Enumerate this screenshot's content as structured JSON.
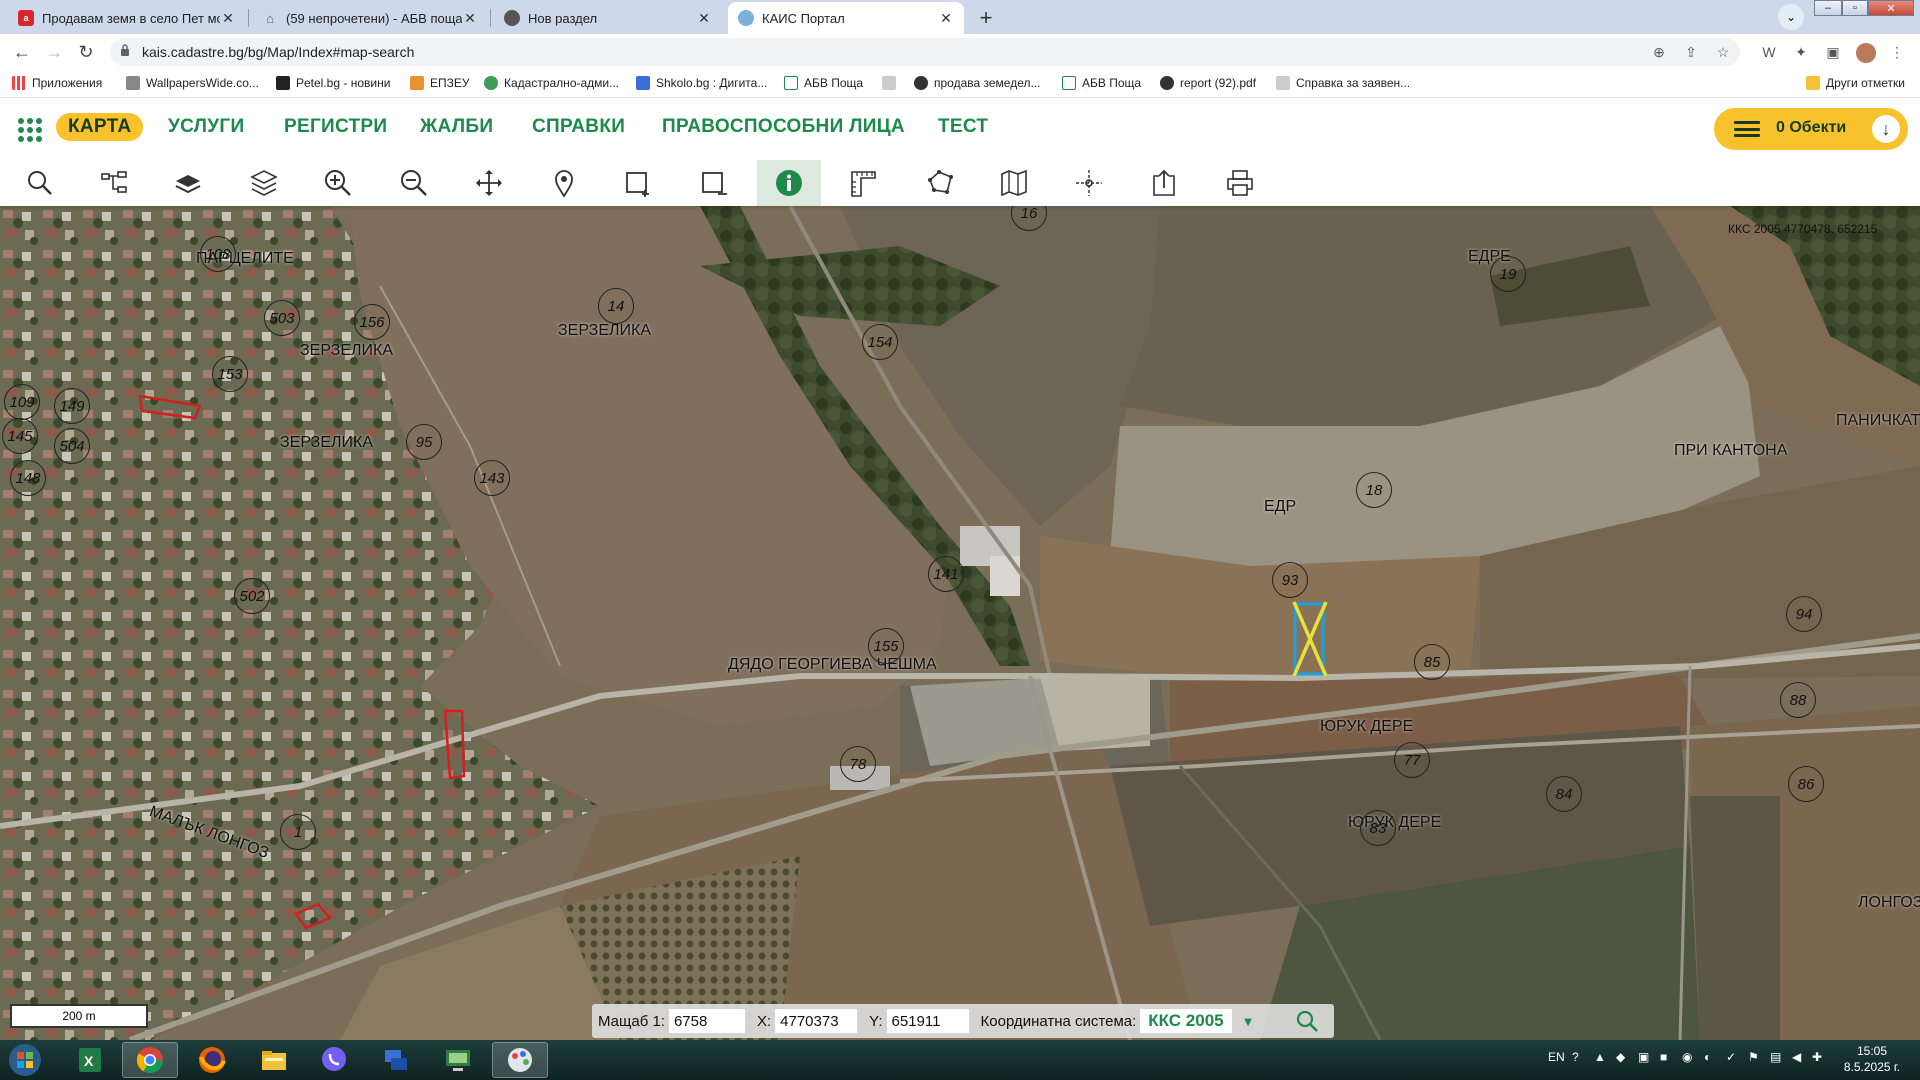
{
  "browser": {
    "tabs": [
      {
        "label": "Продавам земя в село Пет моги",
        "icon": "abv-icon",
        "active": false
      },
      {
        "label": "(59 непрочетени) - АБВ поща",
        "icon": "home-icon",
        "active": false
      },
      {
        "label": "Нов раздел",
        "icon": "chrome-icon",
        "active": false
      },
      {
        "label": "КАИС Портал",
        "icon": "kais-icon",
        "active": true
      }
    ],
    "url": "kais.cadastre.bg/bg/Map/Index#map-search",
    "bookmarks": [
      "Приложения",
      "WallpapersWide.co...",
      "Petel.bg - новини",
      "ЕПЗЕУ",
      "Кадастрално-адми...",
      "Shkolo.bg : Дигита...",
      "АБВ Поща",
      "",
      "продава земедел...",
      "АБВ Поща",
      "report (92).pdf",
      "Справка за заявен..."
    ],
    "other_bookmarks": "Други отметки"
  },
  "app": {
    "nav": [
      "КАРТА",
      "УСЛУГИ",
      "РЕГИСТРИ",
      "ЖАЛБИ",
      "СПРАВКИ",
      "ПРАВОСПОСОБНИ ЛИЦА",
      "ТЕСТ"
    ],
    "objects_label": "0 Обекти",
    "tools": [
      "search-icon",
      "tree-icon",
      "layers-flat-icon",
      "layers-icon",
      "zoom-in-icon",
      "zoom-out-icon",
      "pan-icon",
      "pin-icon",
      "select-add-icon",
      "select-remove-icon",
      "info-icon",
      "ruler-icon",
      "polygon-measure-icon",
      "map-icon",
      "coordinates-icon",
      "export-icon",
      "print-icon"
    ],
    "active_tool": "info-icon",
    "accent": "#1d8a4b",
    "highlight": "#f7c22b"
  },
  "map": {
    "top_coords": "ККС 2005 4770478, 652215",
    "locality_labels": [
      "ПАРЦЕЛИТЕ",
      "ЗЕРЗЕЛИКА",
      "ЗЕРЗЕЛИКА",
      "ЗЕРЗЕЛИКА",
      "ЕДРЕ",
      "ПАНИЧКАТ",
      "ПРИ КАНТОНА",
      "ДЯДО ГЕОРГИЕВА ЧЕШМА",
      "ЮРУК ДЕРЕ",
      "ЮРУК ДЕРЕ",
      "МАЛЪК ЛОНГОЗ",
      "ЛОНГОЗ",
      "ЕДР"
    ],
    "parcel_numbers": [
      "16",
      "14",
      "19",
      "108",
      "503",
      "156",
      "153",
      "154",
      "109",
      "149",
      "145",
      "504",
      "95",
      "143",
      "148",
      "18",
      "93",
      "141",
      "502",
      "155",
      "94",
      "85",
      "88",
      "78",
      "77",
      "86",
      "84",
      "83",
      "1"
    ],
    "scale_bar": "200 m"
  },
  "bottom": {
    "scale_label": "Мащаб 1:",
    "scale_value": "6758",
    "x_label": "X:",
    "x_value": "4770373",
    "y_label": "Y:",
    "y_value": "651911",
    "coord_system_label": "Координатна система:",
    "coord_system_value": "ККС 2005"
  },
  "taskbar": {
    "language": "EN",
    "time": "15:05",
    "date": "8.5.2025 г."
  }
}
